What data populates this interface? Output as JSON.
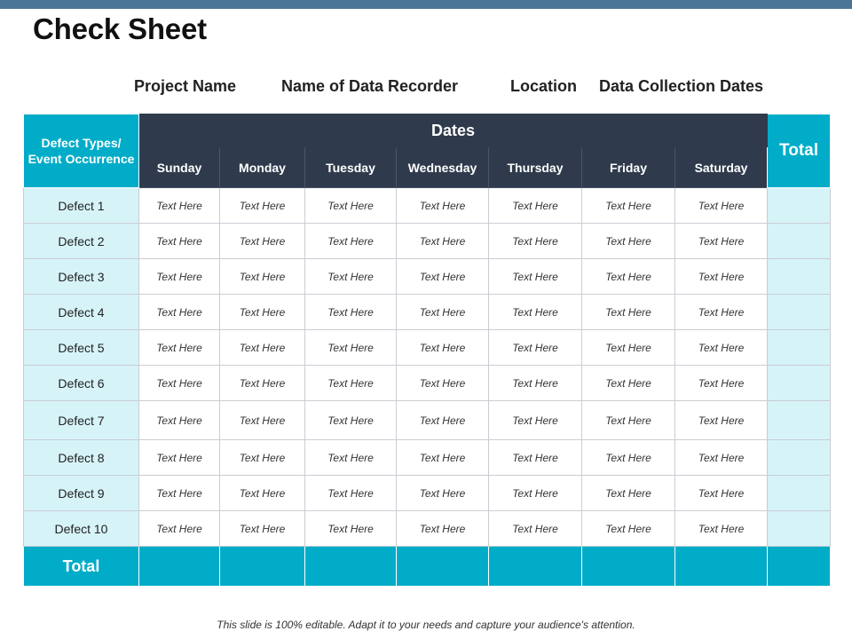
{
  "title": "Check Sheet",
  "meta_fields": [
    "Project Name",
    "Name of Data Recorder",
    "Location",
    "Data Collection Dates"
  ],
  "table": {
    "defect_header": "Defect Types/ Event Occurrence",
    "dates_header": "Dates",
    "total_header": "Total",
    "days": [
      "Sunday",
      "Monday",
      "Tuesday",
      "Wednesday",
      "Thursday",
      "Friday",
      "Saturday"
    ],
    "rows": [
      {
        "label": "Defect 1",
        "cells": [
          "Text Here",
          "Text Here",
          "Text Here",
          "Text Here",
          "Text Here",
          "Text Here",
          "Text Here"
        ]
      },
      {
        "label": "Defect 2",
        "cells": [
          "Text Here",
          "Text Here",
          "Text Here",
          "Text Here",
          "Text Here",
          "Text Here",
          "Text Here"
        ]
      },
      {
        "label": "Defect 3",
        "cells": [
          "Text Here",
          "Text Here",
          "Text Here",
          "Text Here",
          "Text Here",
          "Text Here",
          "Text Here"
        ]
      },
      {
        "label": "Defect 4",
        "cells": [
          "Text Here",
          "Text Here",
          "Text Here",
          "Text Here",
          "Text Here",
          "Text Here",
          "Text Here"
        ]
      },
      {
        "label": "Defect 5",
        "cells": [
          "Text Here",
          "Text Here",
          "Text Here",
          "Text Here",
          "Text Here",
          "Text Here",
          "Text Here"
        ]
      },
      {
        "label": "Defect 6",
        "cells": [
          "Text Here",
          "Text Here",
          "Text Here",
          "Text Here",
          "Text Here",
          "Text Here",
          "Text Here"
        ]
      },
      {
        "label": "Defect 7",
        "cells": [
          "Text Here",
          "Text Here",
          "Text Here",
          "Text Here",
          "Text Here",
          "Text Here",
          "Text Here"
        ]
      },
      {
        "label": "Defect 8",
        "cells": [
          "Text Here",
          "Text Here",
          "Text Here",
          "Text Here",
          "Text Here",
          "Text Here",
          "Text Here"
        ]
      },
      {
        "label": "Defect 9",
        "cells": [
          "Text Here",
          "Text Here",
          "Text Here",
          "Text Here",
          "Text Here",
          "Text Here",
          "Text Here"
        ]
      },
      {
        "label": "Defect 10",
        "cells": [
          "Text Here",
          "Text Here",
          "Text Here",
          "Text Here",
          "Text Here",
          "Text Here",
          "Text Here"
        ]
      }
    ],
    "footer_label": "Total"
  },
  "footer_note": "This slide is 100% editable. Adapt it to your needs and capture your audience's attention.",
  "colors": {
    "accent": "#00acc8",
    "dark_header": "#2f3b4c",
    "light_row": "#d6f3f8",
    "top_bar": "#4a7596"
  }
}
